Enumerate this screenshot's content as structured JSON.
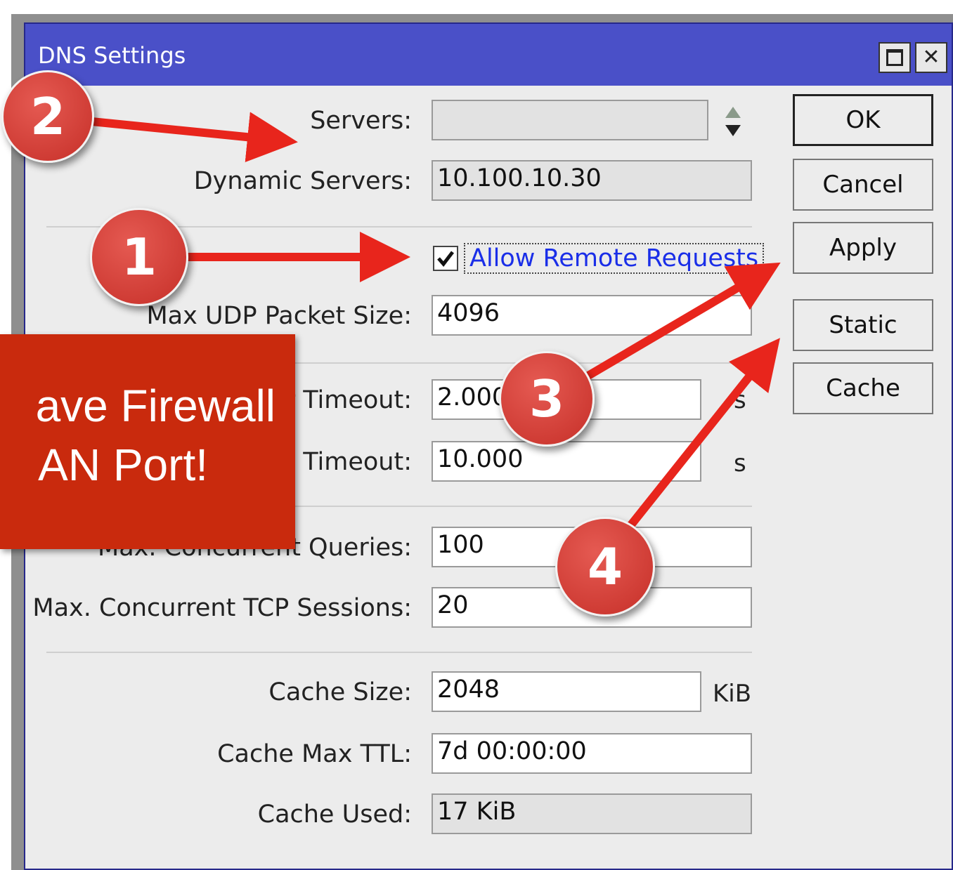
{
  "window": {
    "title": "DNS Settings"
  },
  "form": {
    "servers": {
      "label": "Servers:",
      "value": ""
    },
    "dynamic_servers": {
      "label": "Dynamic Servers:",
      "value": "10.100.10.30"
    },
    "allow_remote_requests": {
      "label": "Allow Remote Requests",
      "checked": true
    },
    "max_udp_packet_size": {
      "label": "Max UDP Packet Size:",
      "value": "4096"
    },
    "query_server_timeout": {
      "label": "r Timeout:",
      "value": "2.000",
      "unit": "s"
    },
    "query_total_timeout": {
      "label": "l Timeout:",
      "value": "10.000",
      "unit": "s"
    },
    "max_concurrent_queries": {
      "label": "Max. Concurrent Queries:",
      "value": "100"
    },
    "max_concurrent_tcp_sessions": {
      "label": "Max. Concurrent TCP Sessions:",
      "value": "20"
    },
    "cache_size": {
      "label": "Cache Size:",
      "value": "2048",
      "unit": "KiB"
    },
    "cache_max_ttl": {
      "label": "Cache Max TTL:",
      "value": "7d 00:00:00"
    },
    "cache_used": {
      "label": "Cache Used:",
      "value": "17 KiB"
    }
  },
  "buttons": {
    "ok": "OK",
    "cancel": "Cancel",
    "apply": "Apply",
    "static": "Static",
    "cache": "Cache"
  },
  "annotations": {
    "badges": [
      "1",
      "2",
      "3",
      "4"
    ],
    "callout_line1": "ave Firewall",
    "callout_line2": "AN Port!",
    "callout_color": "#c92a0d",
    "arrow_color": "#e8251c"
  }
}
